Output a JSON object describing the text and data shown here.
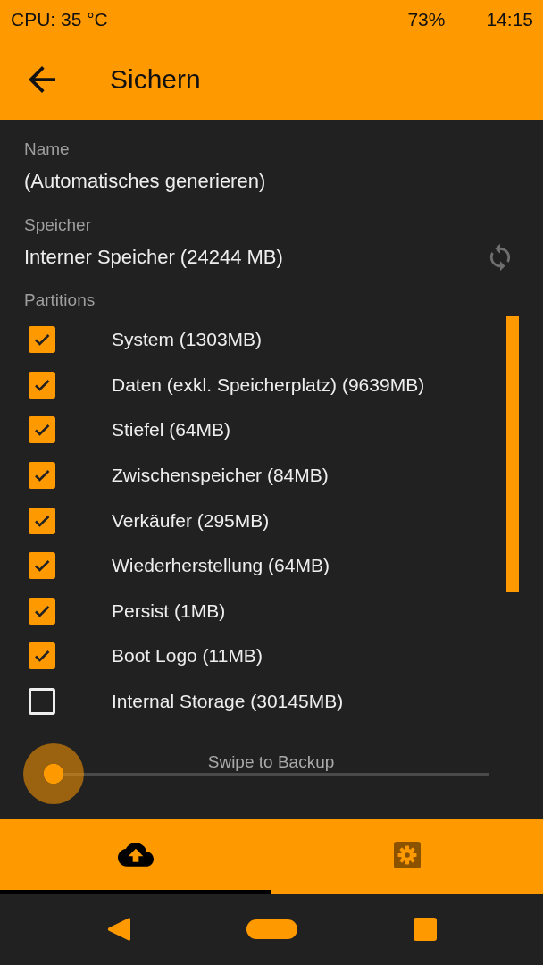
{
  "status_bar": {
    "cpu": "CPU: 35 °C",
    "battery": "73%",
    "time": "14:15"
  },
  "header": {
    "title": "Sichern"
  },
  "form": {
    "name": {
      "label": "Name",
      "value": "(Automatisches generieren)"
    },
    "storage": {
      "label": "Speicher",
      "value": "Interner Speicher (24244 MB)"
    }
  },
  "partitions": {
    "label": "Partitions",
    "items": [
      {
        "label": "System (1303MB)",
        "checked": true
      },
      {
        "label": "Daten (exkl. Speicherplatz) (9639MB)",
        "checked": true
      },
      {
        "label": "Stiefel (64MB)",
        "checked": true
      },
      {
        "label": "Zwischenspeicher (84MB)",
        "checked": true
      },
      {
        "label": "Verkäufer (295MB)",
        "checked": true
      },
      {
        "label": "Wiederherstellung (64MB)",
        "checked": true
      },
      {
        "label": "Persist (1MB)",
        "checked": true
      },
      {
        "label": "Boot Logo (11MB)",
        "checked": true
      },
      {
        "label": "Internal Storage (30145MB)",
        "checked": false
      }
    ]
  },
  "swipe": {
    "label": "Swipe to Backup",
    "level": 0
  },
  "tabs": [
    {
      "kind": "backup",
      "selected": true
    },
    {
      "kind": "settings",
      "selected": false
    }
  ]
}
